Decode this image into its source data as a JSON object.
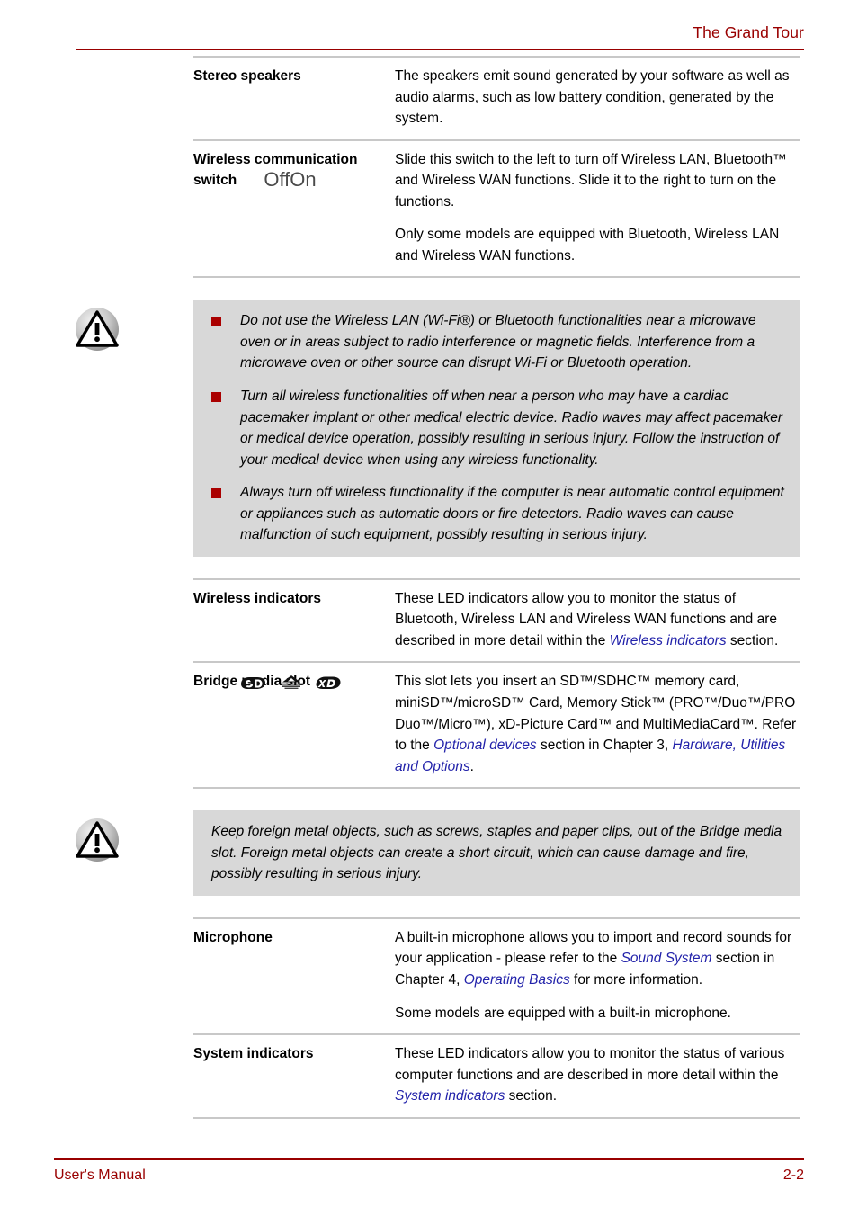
{
  "header": {
    "title": "The Grand Tour"
  },
  "footer": {
    "left": "User's Manual",
    "page": "2-2"
  },
  "gutter": {
    "switch_off_label": "Off",
    "switch_on_label": "On",
    "card_icons": [
      "sd-card-icon",
      "memory-stick-icon",
      "xd-picture-card-icon"
    ],
    "caution_icon": "caution-triangle-icon"
  },
  "rows": [
    {
      "term": "Stereo speakers",
      "paragraphs": [
        "The speakers emit sound generated by your software as well as audio alarms, such as low battery condition, generated by the system."
      ]
    },
    {
      "term": "Wireless communication switch",
      "paragraphs": [
        "Slide this switch to the left to turn off Wireless LAN, Bluetooth™ and Wireless WAN functions. Slide it to the right to turn on the functions.",
        "Only some models are equipped with Bluetooth, Wireless LAN and Wireless WAN functions."
      ]
    }
  ],
  "caution_wireless": {
    "bullets": [
      "Do not use the Wireless LAN (Wi-Fi®) or Bluetooth functionalities near a microwave oven or in areas subject to radio interference or magnetic fields. Interference from a microwave oven or other source can disrupt Wi-Fi or Bluetooth operation.",
      "Turn all wireless functionalities off when near a person who may have a cardiac pacemaker implant or other medical electric device. Radio waves may affect pacemaker or medical device operation, possibly resulting in serious injury. Follow the instruction of your medical device when using any wireless functionality.",
      "Always turn off wireless functionality if the computer is near automatic control equipment or appliances such as automatic doors or fire detectors. Radio waves can cause malfunction of such equipment, possibly resulting in serious injury."
    ]
  },
  "wireless_indicators": {
    "term": "Wireless indicators",
    "text_before": "These LED indicators allow you to monitor the status of Bluetooth, Wireless LAN and Wireless WAN functions and are described in more detail within the ",
    "link": "Wireless indicators",
    "text_after": " section."
  },
  "bridge_media_slot": {
    "term": "Bridge media slot",
    "text_1": "This slot lets you insert an SD™/SDHC™ memory card, miniSD™/microSD™ Card, Memory Stick™ (PRO™/Duo™/PRO Duo™/Micro™), xD-Picture Card™ and MultiMediaCard™. Refer to the ",
    "link_1": "Optional devices",
    "text_2": " section in Chapter 3, ",
    "link_2": "Hardware, Utilities and Options",
    "text_3": "."
  },
  "caution_metal": {
    "text": "Keep foreign metal objects, such as screws, staples and paper clips, out of the Bridge media slot. Foreign metal objects can create a short circuit, which can cause damage and fire, possibly resulting in serious injury."
  },
  "microphone": {
    "term": "Microphone",
    "text_1": "A built-in microphone allows you to import and record sounds for your application - please refer to the ",
    "link_1": "Sound System",
    "text_2": " section in Chapter 4, ",
    "link_2": "Operating Basics",
    "text_3": " for more information.",
    "paragraph_2": "Some models are equipped with a built-in microphone."
  },
  "system_indicators": {
    "term": "System indicators",
    "text_before": "These LED indicators allow you to monitor the status of various computer functions and are described in more detail within the ",
    "link": "System indicators",
    "text_after": " section."
  },
  "colors": {
    "brand_red": "#990000",
    "bullet_red": "#aa0000",
    "note_bg": "#d8d8d8",
    "link_blue": "#2222aa",
    "rule_gray": "#c8c8c8"
  }
}
